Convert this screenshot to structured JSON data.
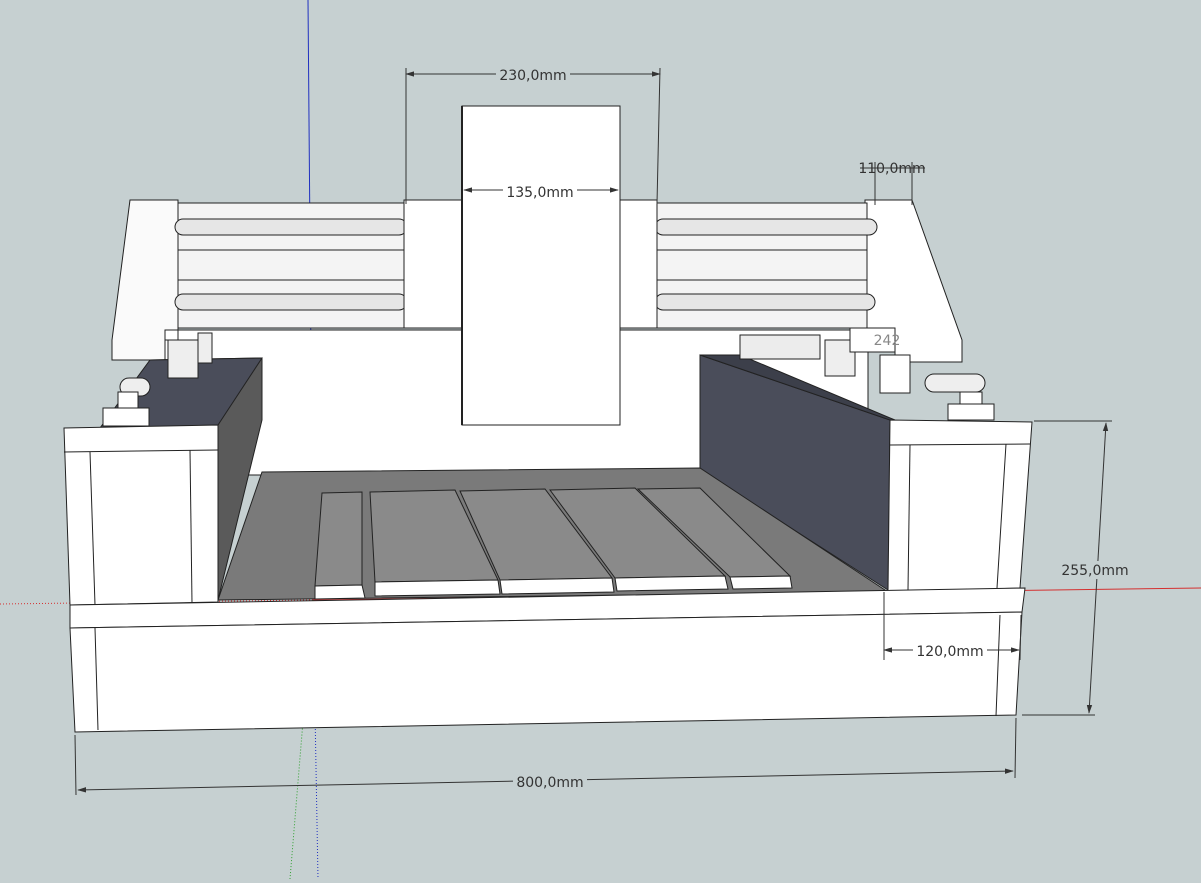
{
  "dimensions": {
    "gantry_width": "230,0mm",
    "spindle_width": "135,0mm",
    "rail_offset": "110,0mm",
    "side_height": "255,0mm",
    "side_depth": "120,0mm",
    "base_length": "800,0mm",
    "partial_label": "242"
  },
  "colors": {
    "background": "#c6d0d1",
    "face_light": "#ffffff",
    "face_shade": "#ececec",
    "bed": "#7a7a7a",
    "slat": "#8a8a8a",
    "dark_panel": "#4a4d5a",
    "dark_panel_side": "#5a5a5a",
    "axis_red": "#d43030",
    "axis_blue": "#2030c0",
    "axis_green": "#30a030",
    "dim_line": "#333333"
  }
}
